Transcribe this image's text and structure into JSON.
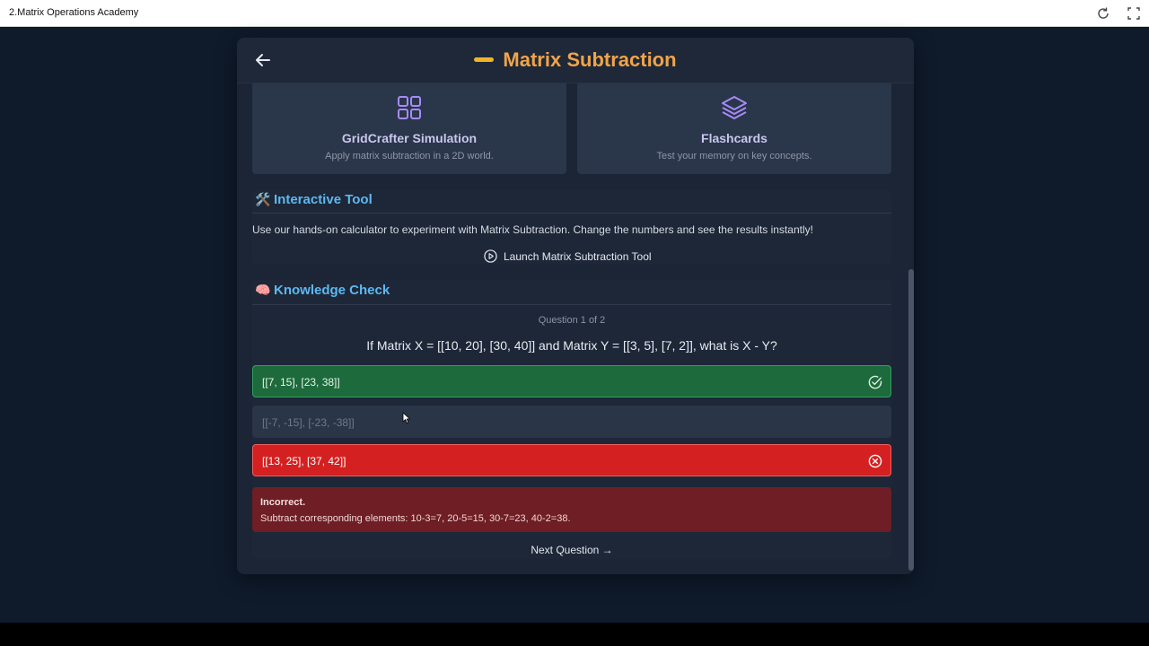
{
  "window": {
    "title": "2.Matrix Operations Academy",
    "reload_icon": "reload-icon",
    "expand_icon": "expand-icon"
  },
  "header": {
    "title": "Matrix Subtraction",
    "back_icon": "arrow-left-icon",
    "accent": "#f0a44a"
  },
  "cards": [
    {
      "title": "GridCrafter Simulation",
      "subtitle": "Apply matrix subtraction in a 2D world.",
      "icon": "grid-icon"
    },
    {
      "title": "Flashcards",
      "subtitle": "Test your memory on key concepts.",
      "icon": "layers-icon"
    }
  ],
  "tool": {
    "emoji": "🛠️",
    "title": "Interactive Tool",
    "description": "Use our hands-on calculator to experiment with Matrix Subtraction. Change the numbers and see the results instantly!",
    "launch_label": "Launch Matrix Subtraction Tool",
    "launch_icon": "play-circle-icon"
  },
  "quiz": {
    "emoji": "🧠",
    "title": "Knowledge Check",
    "counter": "Question 1 of 2",
    "question": "If Matrix X = [[10, 20], [30, 40]] and Matrix Y = [[3, 5], [7, 2]], what is X - Y?",
    "options": [
      {
        "text": "[[7, 15], [23, 38]]",
        "state": "correct",
        "icon": "check-circle-icon"
      },
      {
        "text": "[[-7, -15], [-23, -38]]",
        "state": "neutral"
      },
      {
        "text": "[[13, 25], [37, 42]]",
        "state": "wrong",
        "icon": "x-circle-icon"
      }
    ],
    "feedback": {
      "heading": "Incorrect.",
      "body": "Subtract corresponding elements: 10-3=7, 20-5=15, 30-7=23, 40-2=38."
    },
    "next_label": "Next Question →"
  },
  "colors": {
    "correct": "#1d6a3c",
    "wrong": "#d42020",
    "feedback": "#6e1e24",
    "section_title": "#5db8f0",
    "card_title": "#c9c6ee"
  }
}
